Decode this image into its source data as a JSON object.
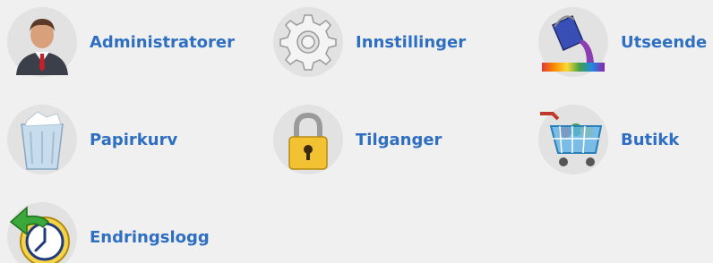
{
  "items": [
    {
      "label": "Administratorer",
      "icon": "admin-user-icon"
    },
    {
      "label": "Innstillinger",
      "icon": "gear-icon"
    },
    {
      "label": "Utseende",
      "icon": "paint-bucket-icon"
    },
    {
      "label": "Papirkurv",
      "icon": "trash-bin-icon"
    },
    {
      "label": "Tilganger",
      "icon": "padlock-icon"
    },
    {
      "label": "Butikk",
      "icon": "shopping-cart-icon"
    },
    {
      "label": "Endringslogg",
      "icon": "history-clock-icon"
    }
  ],
  "colors": {
    "link": "#2f6fc2",
    "background": "#f0f0f0",
    "icon_circle": "#e2e2e2"
  }
}
